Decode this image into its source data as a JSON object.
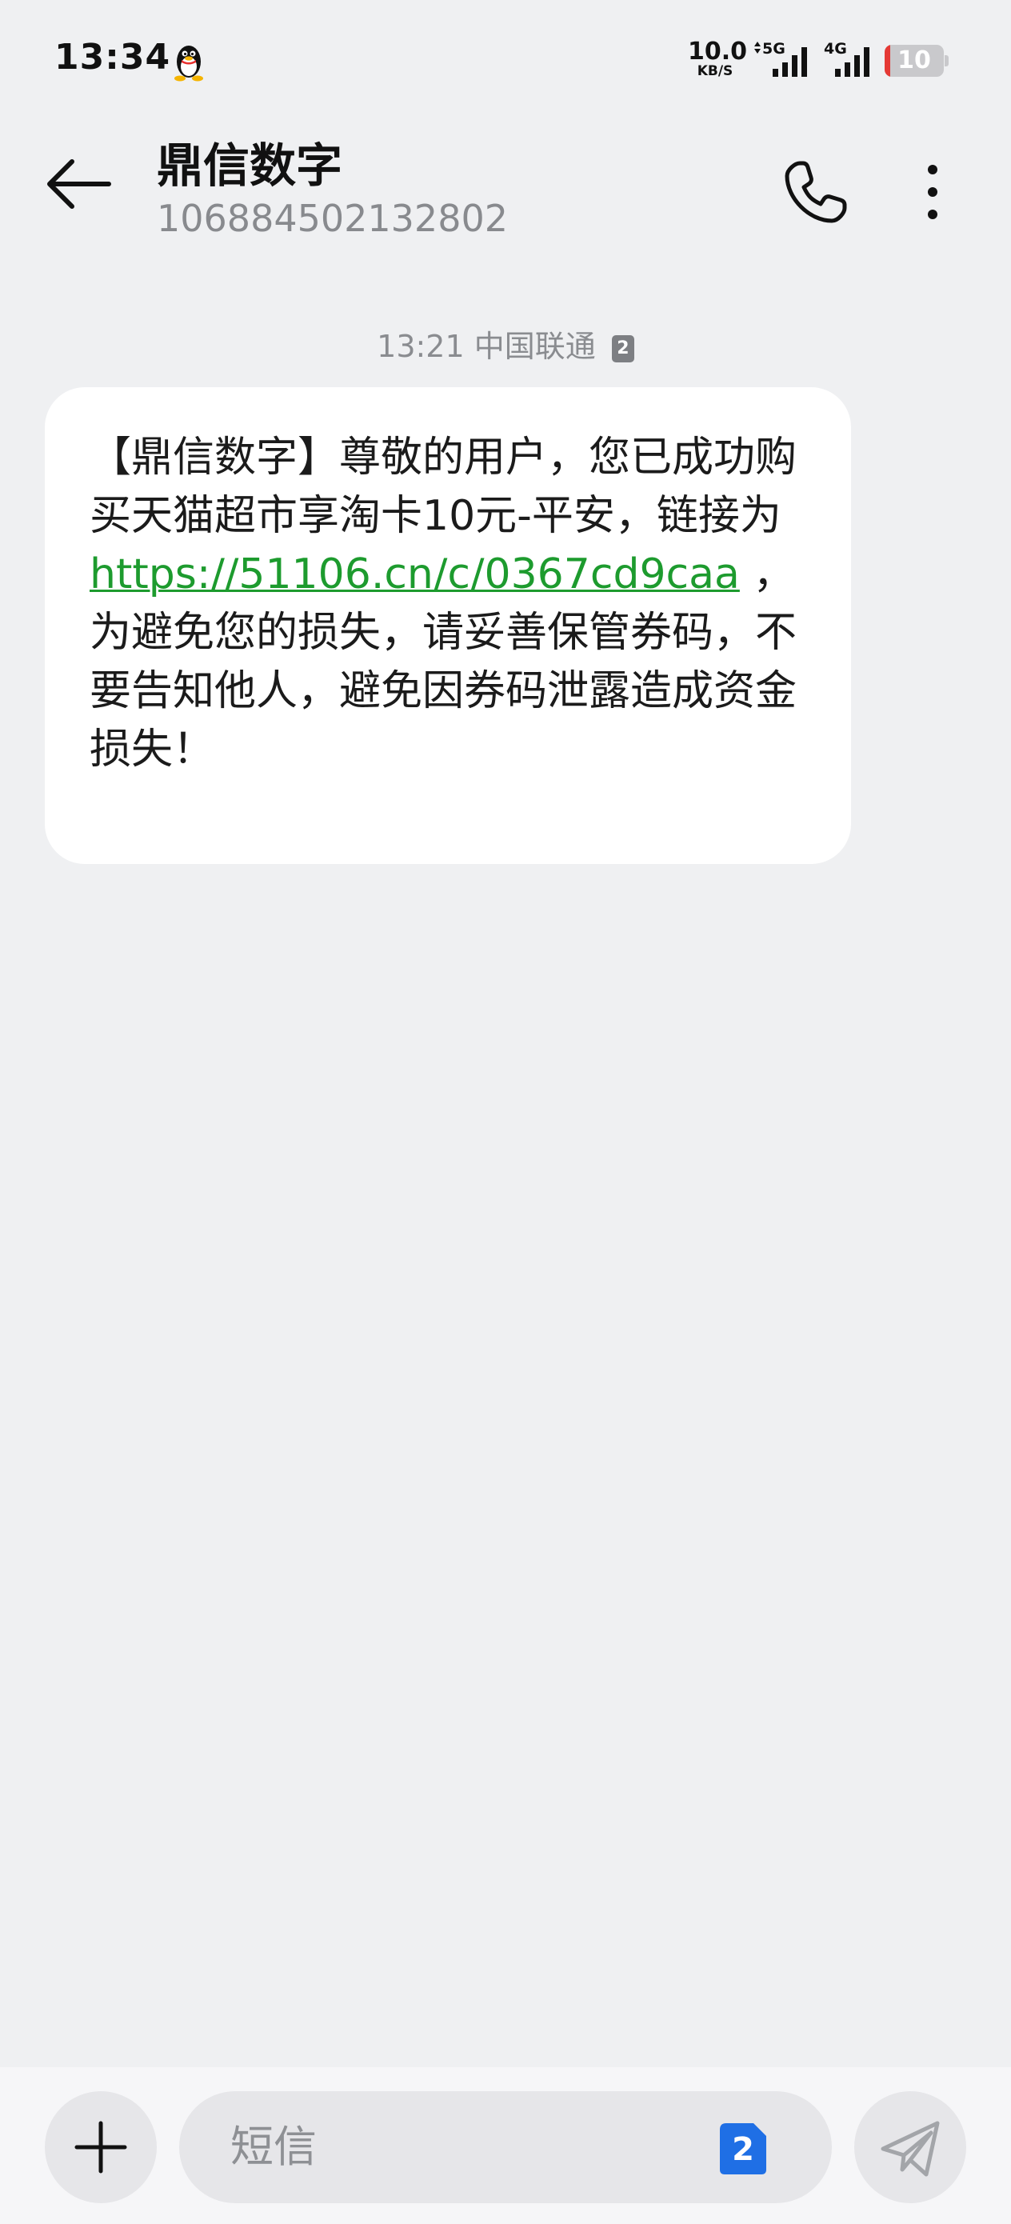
{
  "status_bar": {
    "time": "13:34",
    "net_speed_value": "10.0",
    "net_speed_unit": "KB/S",
    "signal1_type": "5G",
    "signal2_type": "4G",
    "battery_level": "10",
    "battery_fraction": 0.1,
    "battery_color": "#e53935"
  },
  "header": {
    "contact_name": "鼎信数字",
    "contact_number": "106884502132802",
    "back_icon": "arrow-left-icon",
    "call_icon": "phone-icon",
    "more_icon": "more-vertical-icon"
  },
  "conversation": {
    "time": "13:21",
    "carrier": "中国联通",
    "sim_slot": "2",
    "message": {
      "text_before_link": "【鼎信数字】尊敬的用户，您已成功购买天猫超市享淘卡10元-平安，链接为",
      "link": "https://51106.cn/c/0367cd9caa",
      "text_after_link": " ，为避免您的损失，请妥善保管券码，不要告知他人，避免因券码泄露造成资金损失！",
      "link_color": "#1d9b2e"
    }
  },
  "composer": {
    "placeholder": "短信",
    "sim_slot": "2",
    "sim_color": "#1f6fe5",
    "add_icon": "plus-icon",
    "send_icon": "send-icon"
  }
}
